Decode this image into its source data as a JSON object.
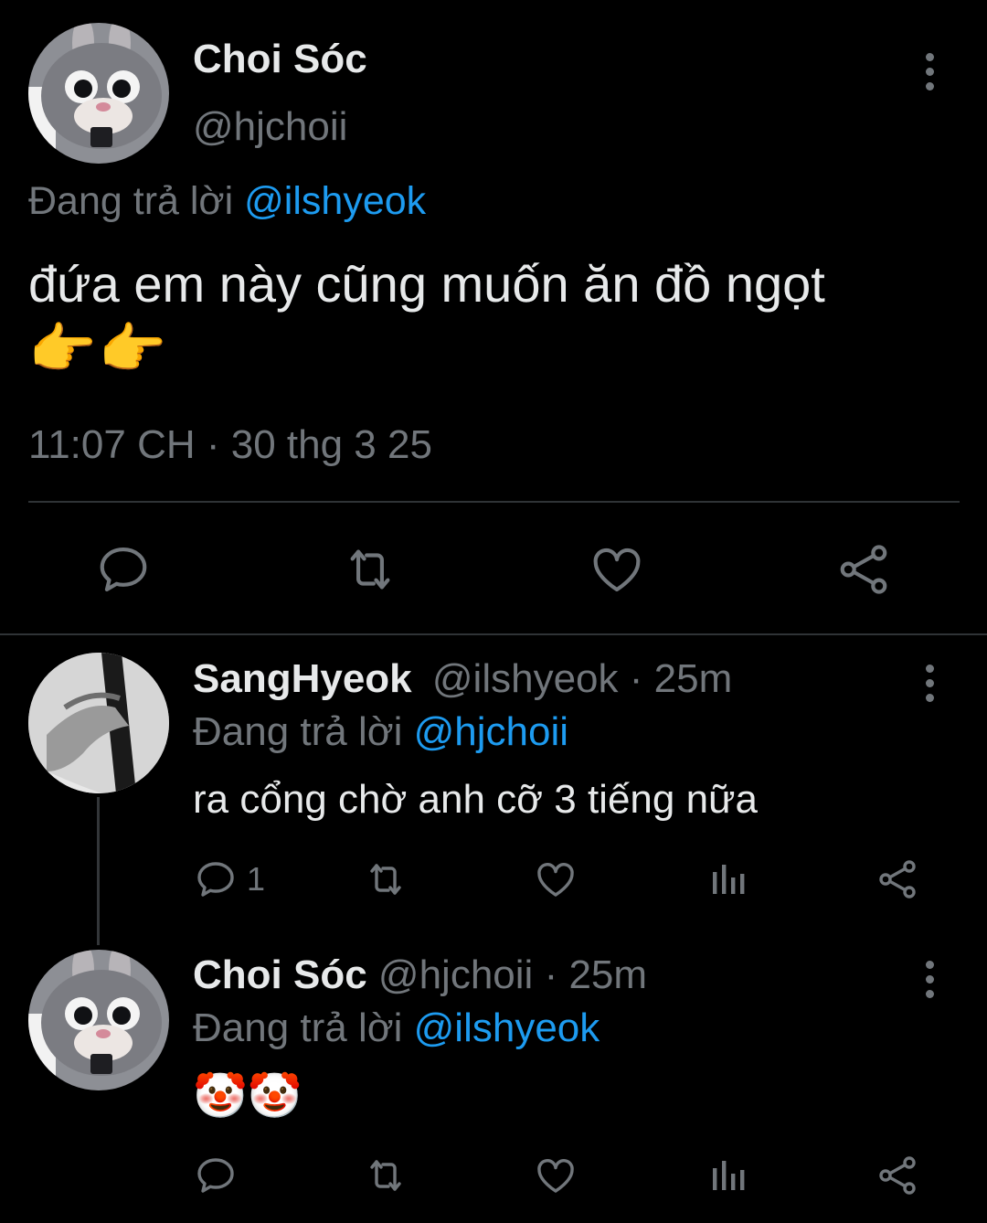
{
  "main_tweet": {
    "display_name": "Choi Sóc",
    "handle": "@hjchoii",
    "reply_prefix": "Đang trả lời",
    "reply_to": "@ilshyeok",
    "text": "đứa em này cũng muốn ăn đồ ngọt",
    "emojis": "👉👉",
    "timestamp": "11:07 CH · 30 thg 3 25"
  },
  "replies": [
    {
      "display_name": "SangHyeok",
      "handle": "@ilshyeok",
      "time": "· 25m",
      "reply_prefix": "Đang trả lời",
      "reply_to": "@hjchoii",
      "text": "ra cổng chờ anh cỡ 3 tiếng nữa",
      "reply_count": "1"
    },
    {
      "display_name": "Choi Sóc",
      "handle": "@hjchoii",
      "time": "· 25m",
      "reply_prefix": "Đang trả lời",
      "reply_to": "@ilshyeok",
      "text": "🤡🤡"
    }
  ],
  "icons": {
    "reply": "reply-icon",
    "retweet": "retweet-icon",
    "like": "heart-icon",
    "views": "views-icon",
    "share": "share-icon",
    "more": "more-icon"
  },
  "colors": {
    "background": "#000000",
    "text": "#e7e9ea",
    "muted": "#71767b",
    "link": "#1d9bf0"
  }
}
